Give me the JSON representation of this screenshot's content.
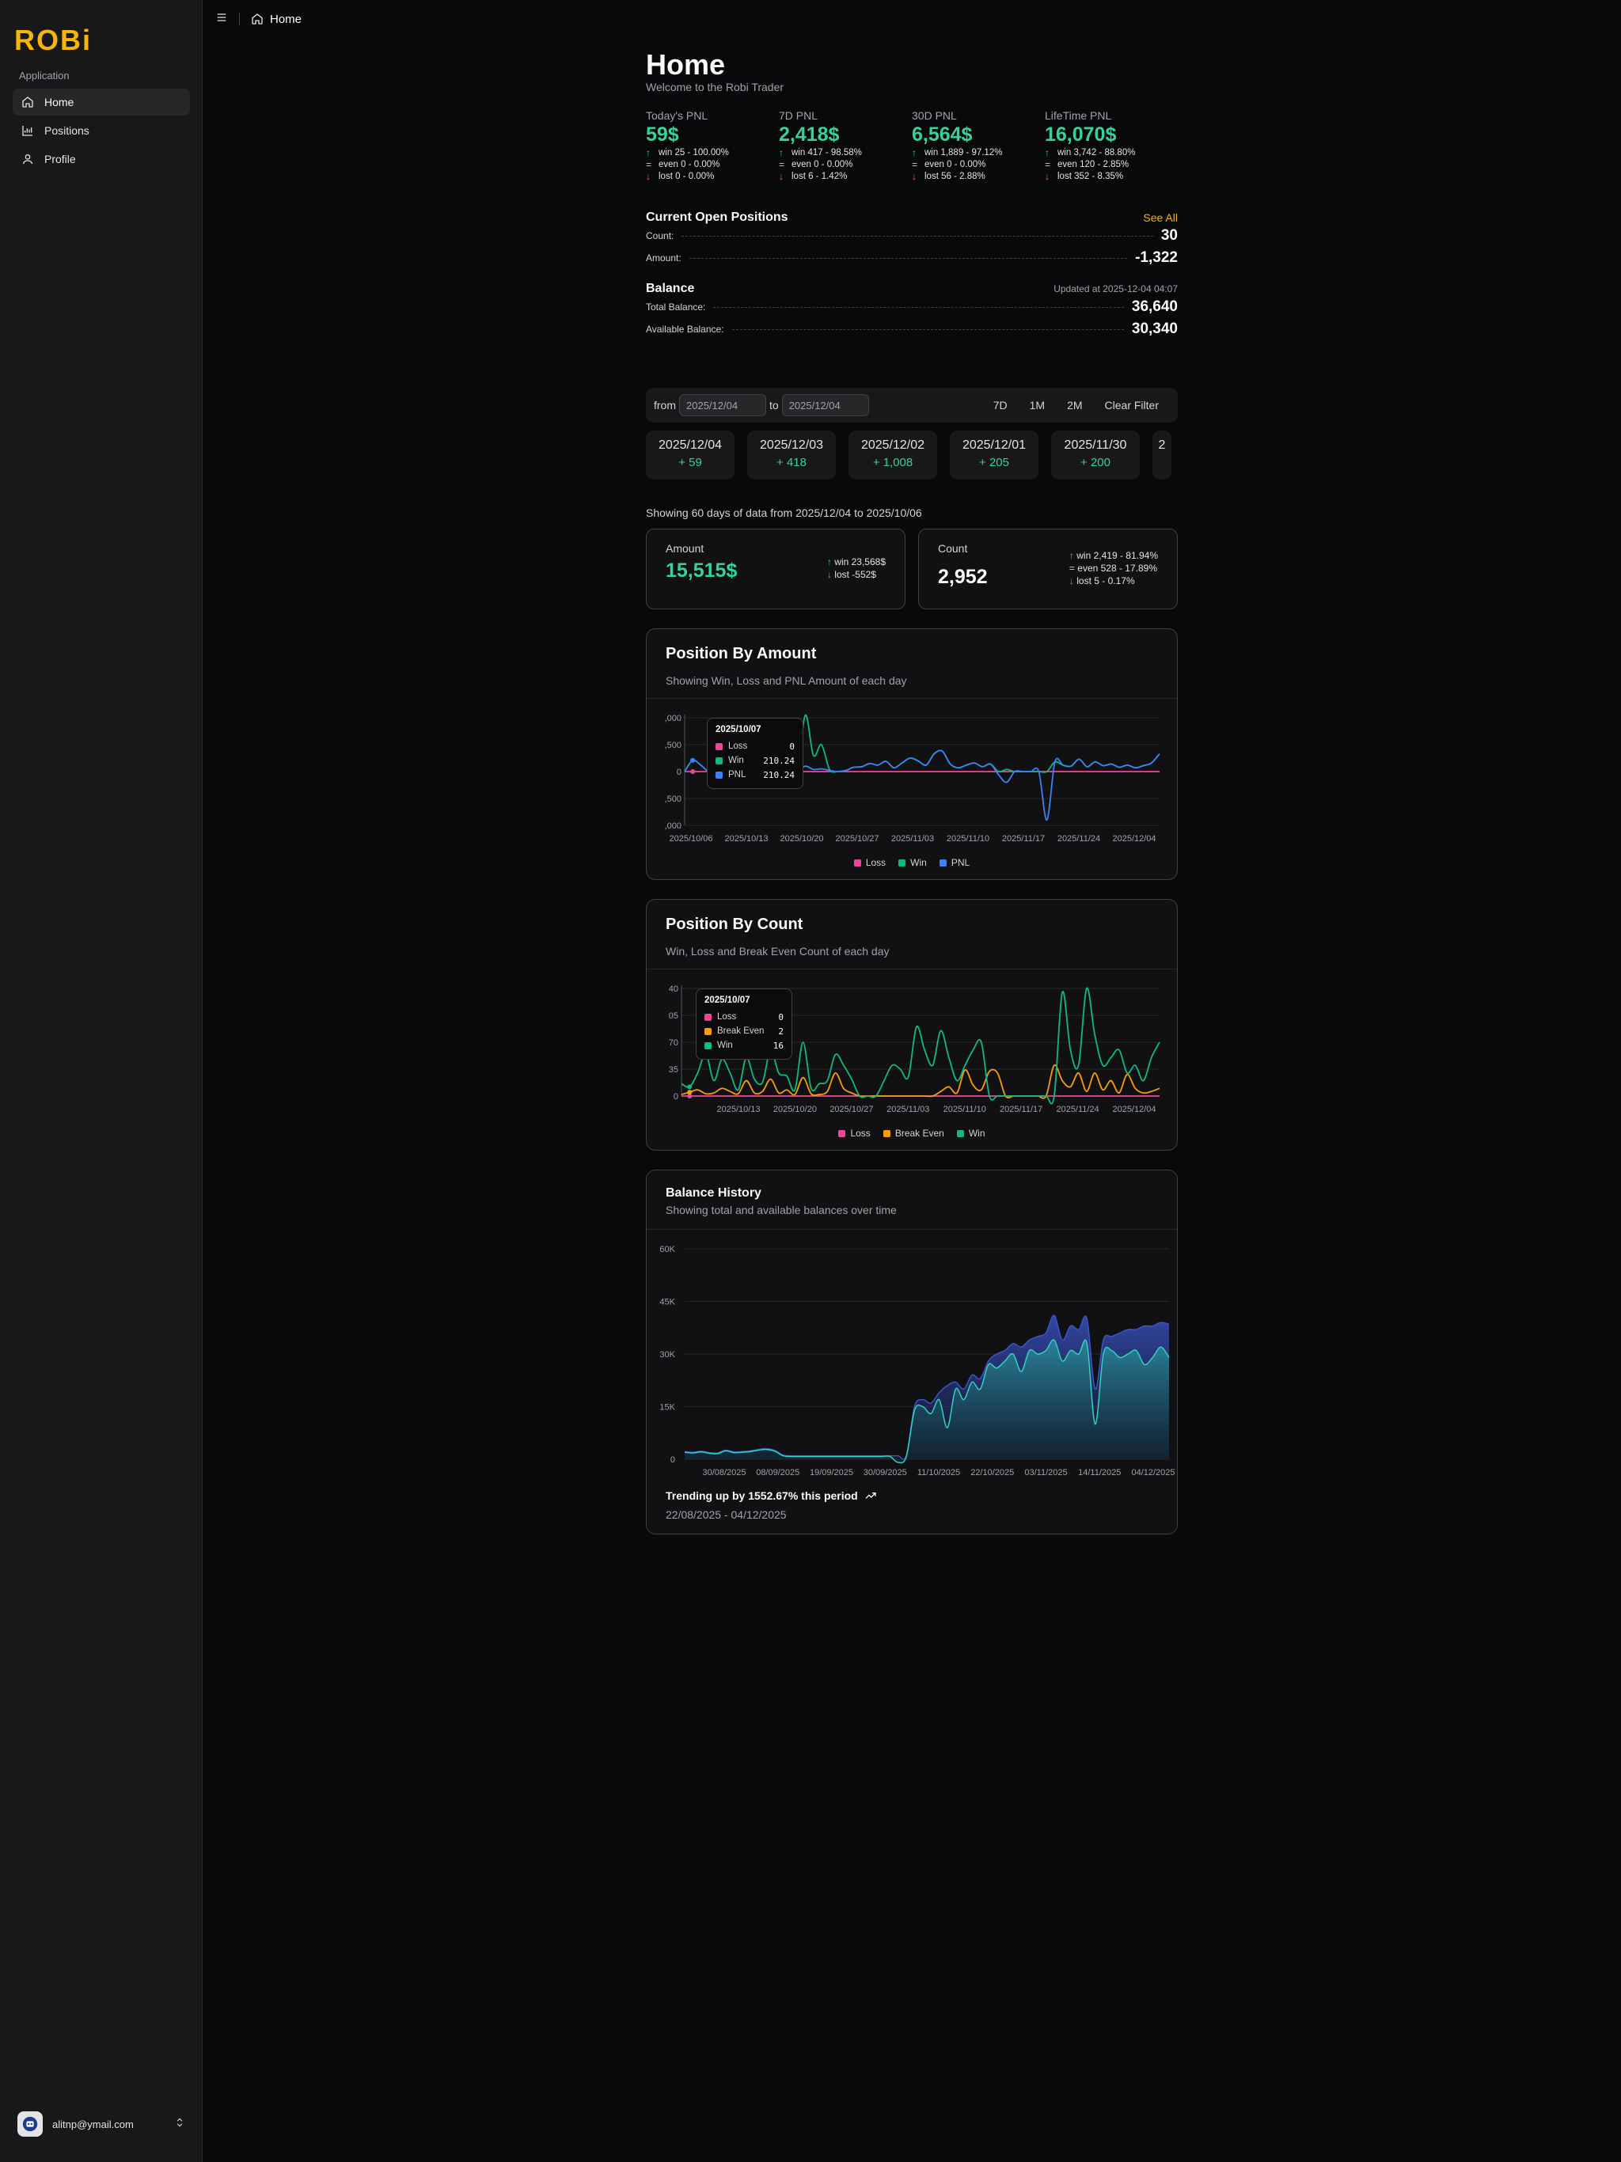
{
  "app": {
    "logo": "ROBi"
  },
  "sidebar": {
    "group_label": "Application",
    "items": [
      {
        "label": "Home",
        "icon": "home-icon",
        "active": true
      },
      {
        "label": "Positions",
        "icon": "chart-icon",
        "active": false
      },
      {
        "label": "Profile",
        "icon": "user-icon",
        "active": false
      }
    ],
    "user_email": "alitnp@ymail.com"
  },
  "breadcrumb": {
    "label": "Home"
  },
  "header": {
    "title": "Home",
    "subtitle": "Welcome to the Robi Trader"
  },
  "pnl": [
    {
      "label": "Today's PNL",
      "value": "59$",
      "win": "win 25 - 100.00%",
      "even": "even 0 - 0.00%",
      "lost": "lost 0 - 0.00%"
    },
    {
      "label": "7D PNL",
      "value": "2,418$",
      "win": "win 417 - 98.58%",
      "even": "even 0 - 0.00%",
      "lost": "lost 6 - 1.42%"
    },
    {
      "label": "30D PNL",
      "value": "6,564$",
      "win": "win 1,889 - 97.12%",
      "even": "even 0 - 0.00%",
      "lost": "lost 56 - 2.88%"
    },
    {
      "label": "LifeTime PNL",
      "value": "16,070$",
      "win": "win 3,742 - 88.80%",
      "even": "even 120 - 2.85%",
      "lost": "lost 352 - 8.35%"
    }
  ],
  "open_positions": {
    "title": "Current Open Positions",
    "see_all": "See All",
    "count_label": "Count:",
    "count": "30",
    "amount_label": "Amount:",
    "amount": "-1,322"
  },
  "balance": {
    "title": "Balance",
    "updated": "Updated at 2025-12-04 04:07",
    "total_label": "Total Balance:",
    "total": "36,640",
    "available_label": "Available Balance:",
    "available": "30,340"
  },
  "filter": {
    "from_label": "from",
    "from": "2025/12/04",
    "to_label": "to",
    "to": "2025/12/04",
    "btn_7d": "7D",
    "btn_1m": "1M",
    "btn_2m": "2M",
    "clear": "Clear Filter"
  },
  "days": [
    {
      "date": "2025/12/04",
      "value": "+ 59"
    },
    {
      "date": "2025/12/03",
      "value": "+ 418"
    },
    {
      "date": "2025/12/02",
      "value": "+ 1,008"
    },
    {
      "date": "2025/12/01",
      "value": "+ 205"
    },
    {
      "date": "2025/11/30",
      "value": "+ 200"
    },
    {
      "date": "2",
      "value": ""
    }
  ],
  "showing": "Showing 60 days of data from 2025/12/04 to 2025/10/06",
  "summary": {
    "amount_label": "Amount",
    "amount": "15,515$",
    "amount_win": "win 23,568$",
    "amount_lost": "lost -552$",
    "count_label": "Count",
    "count": "2,952",
    "count_win": "win 2,419 - 81.94%",
    "count_even": "even 528 - 17.89%",
    "count_lost": "lost 5 - 0.17%"
  },
  "colors": {
    "win": "#34d399",
    "loss": "#f87171",
    "accent": "#f5b50a",
    "pnl": "#3b82f6",
    "break_even": "#f59e0b"
  },
  "charts": {
    "amount": {
      "title": "Position By Amount",
      "desc": "Showing Win, Loss and PNL Amount of each day",
      "tooltip": {
        "title": "2025/10/07",
        "rows": [
          {
            "name": "Loss",
            "value": "0",
            "color": "#ec4899"
          },
          {
            "name": "Win",
            "value": "210.24",
            "color": "#10b981"
          },
          {
            "name": "PNL",
            "value": "210.24",
            "color": "#3b82f6"
          }
        ]
      },
      "legend": [
        {
          "name": "Loss",
          "color": "#ec4899"
        },
        {
          "name": "Win",
          "color": "#10b981"
        },
        {
          "name": "PNL",
          "color": "#3b82f6"
        }
      ]
    },
    "count": {
      "title": "Position By Count",
      "desc": "Win, Loss and Break Even Count of each day",
      "tooltip": {
        "title": "2025/10/07",
        "rows": [
          {
            "name": "Loss",
            "value": "0",
            "color": "#ec4899"
          },
          {
            "name": "Break Even",
            "value": "2",
            "color": "#f59e0b"
          },
          {
            "name": "Win",
            "value": "16",
            "color": "#10b981"
          }
        ]
      },
      "legend": [
        {
          "name": "Loss",
          "color": "#ec4899"
        },
        {
          "name": "Break Even",
          "color": "#f59e0b"
        },
        {
          "name": "Win",
          "color": "#10b981"
        }
      ]
    },
    "balance": {
      "title": "Balance History",
      "desc": "Showing total and available balances over time",
      "trend": "Trending up by 1552.67% this period",
      "range": "22/08/2025 - 04/12/2025"
    }
  },
  "chart_data": [
    {
      "type": "line",
      "title": "Position By Amount",
      "x": [
        "2025/10/06",
        "2025/10/13",
        "2025/10/20",
        "2025/10/27",
        "2025/11/03",
        "2025/11/10",
        "2025/11/17",
        "2025/11/24",
        "2025/12/04"
      ],
      "xticks": [
        "2025/10/06",
        "2025/10/13",
        "2025/10/20",
        "2025/10/27",
        "2025/11/03",
        "2025/11/10",
        "2025/11/17",
        "2025/11/24",
        "2025/12/04"
      ],
      "yticks": [
        ",000",
        ",500",
        "0",
        ",500",
        ",000"
      ],
      "ylim": [
        -1000,
        1000
      ],
      "series": [
        {
          "name": "Loss",
          "color": "#ec4899",
          "values": [
            0,
            0,
            0,
            0,
            0,
            0,
            0,
            0,
            0,
            0,
            0,
            0,
            0,
            0,
            0,
            0,
            0,
            0,
            0,
            0,
            0,
            0,
            0,
            0,
            0,
            0,
            0,
            0,
            0,
            0,
            0,
            0,
            0,
            0,
            0,
            0,
            0,
            0,
            0,
            0,
            0,
            0,
            0,
            0,
            0,
            0,
            0,
            0,
            0,
            0,
            0,
            0,
            0,
            0,
            0,
            0,
            0,
            0,
            0,
            0
          ]
        },
        {
          "name": "Win",
          "color": "#10b981",
          "values": [
            0,
            210,
            120,
            0,
            0,
            0,
            0,
            0,
            0,
            0,
            0,
            0,
            0,
            0,
            0,
            1050,
            300,
            500,
            40,
            0,
            20,
            80,
            90,
            150,
            120,
            190,
            70,
            160,
            250,
            200,
            120,
            330,
            380,
            140,
            70,
            120,
            160,
            90,
            140,
            0,
            40,
            0,
            0,
            0,
            0,
            0,
            180,
            120,
            100,
            230,
            90,
            180,
            110,
            140,
            80,
            120,
            70,
            110,
            160,
            330
          ]
        },
        {
          "name": "PNL",
          "color": "#3b82f6",
          "values": [
            0,
            210,
            120,
            0,
            0,
            0,
            0,
            0,
            0,
            0,
            0,
            0,
            0,
            0,
            0,
            100,
            40,
            50,
            20,
            0,
            20,
            80,
            90,
            150,
            120,
            190,
            70,
            160,
            250,
            200,
            120,
            330,
            380,
            140,
            70,
            120,
            160,
            90,
            140,
            -60,
            -200,
            0,
            0,
            0,
            0,
            -900,
            180,
            120,
            100,
            230,
            90,
            180,
            110,
            140,
            80,
            120,
            70,
            110,
            160,
            330
          ]
        }
      ]
    },
    {
      "type": "line",
      "title": "Position By Count",
      "xticks": [
        "2025/10/13",
        "2025/10/20",
        "2025/10/27",
        "2025/11/03",
        "2025/11/10",
        "2025/11/17",
        "2025/11/24",
        "2025/12/04"
      ],
      "yticks": [
        "0",
        "35",
        "70",
        "05",
        "40"
      ],
      "ylim": [
        0,
        140
      ],
      "series": [
        {
          "name": "Loss",
          "color": "#ec4899",
          "values": [
            0,
            0,
            0,
            0,
            0,
            0,
            0,
            0,
            0,
            0,
            0,
            0,
            0,
            0,
            0,
            0,
            0,
            0,
            0,
            0,
            0,
            0,
            0,
            0,
            0,
            0,
            0,
            0,
            0,
            0,
            0,
            0,
            0,
            0,
            0,
            0,
            0,
            0,
            0,
            0,
            0,
            0,
            0,
            0,
            0,
            0,
            0,
            0,
            0,
            0,
            0,
            0,
            0,
            0,
            0,
            0,
            0,
            0,
            0,
            0
          ]
        },
        {
          "name": "Break Even",
          "color": "#f59e0b",
          "values": [
            2,
            5,
            8,
            3,
            4,
            10,
            6,
            3,
            20,
            4,
            6,
            22,
            4,
            8,
            2,
            24,
            3,
            2,
            6,
            30,
            10,
            4,
            0,
            0,
            0,
            0,
            0,
            0,
            0,
            0,
            0,
            0,
            6,
            12,
            4,
            34,
            14,
            8,
            32,
            30,
            0,
            0,
            0,
            0,
            0,
            0,
            40,
            20,
            12,
            30,
            6,
            30,
            8,
            20,
            4,
            28,
            10,
            4,
            6,
            10
          ]
        },
        {
          "name": "Win",
          "color": "#10b981",
          "values": [
            16,
            12,
            30,
            55,
            20,
            48,
            30,
            8,
            50,
            22,
            18,
            60,
            30,
            26,
            8,
            70,
            10,
            16,
            20,
            54,
            40,
            22,
            0,
            0,
            0,
            20,
            40,
            35,
            25,
            90,
            60,
            40,
            85,
            50,
            20,
            40,
            60,
            70,
            0,
            0,
            0,
            0,
            0,
            0,
            0,
            0,
            0,
            135,
            60,
            40,
            140,
            80,
            40,
            50,
            60,
            30,
            40,
            20,
            50,
            70
          ]
        }
      ]
    },
    {
      "type": "area",
      "title": "Balance History",
      "xticks": [
        "30/08/2025",
        "08/09/2025",
        "19/09/2025",
        "30/09/2025",
        "11/10/2025",
        "22/10/2025",
        "03/11/2025",
        "14/11/2025",
        "04/12/2025"
      ],
      "yticks": [
        "0",
        "15K",
        "30K",
        "45K",
        "60K"
      ],
      "ylim": [
        0,
        60000
      ],
      "series": [
        {
          "name": "Total",
          "color": "#3b55c9",
          "values": [
            2200,
            2000,
            2300,
            1900,
            1800,
            2600,
            2100,
            2200,
            2400,
            2800,
            3000,
            2500,
            1200,
            1000,
            1000,
            1000,
            1000,
            1000,
            1000,
            1000,
            1000,
            1000,
            1000,
            1000,
            1000,
            1000,
            1000,
            1000,
            15000,
            17000,
            16000,
            19000,
            21000,
            22000,
            20000,
            24000,
            23000,
            28000,
            30000,
            31000,
            33000,
            32000,
            34000,
            35000,
            36000,
            41000,
            34000,
            38000,
            37000,
            40000,
            20000,
            34000,
            35000,
            36000,
            37000,
            37000,
            38000,
            38000,
            39000,
            38500
          ]
        },
        {
          "name": "Available",
          "color": "#2dd4bf",
          "values": [
            2000,
            1800,
            2100,
            1700,
            1600,
            2400,
            1900,
            2000,
            2200,
            2600,
            2800,
            2300,
            1000,
            800,
            800,
            800,
            800,
            800,
            800,
            800,
            800,
            800,
            800,
            800,
            800,
            800,
            -900,
            800,
            14000,
            15000,
            13000,
            17000,
            9000,
            20000,
            17000,
            22000,
            20000,
            27000,
            26000,
            28000,
            30000,
            25000,
            31000,
            30000,
            31000,
            34000,
            28000,
            31000,
            30000,
            33000,
            10000,
            30000,
            31000,
            29000,
            30000,
            31000,
            27000,
            29000,
            32000,
            29000
          ]
        }
      ]
    }
  ]
}
